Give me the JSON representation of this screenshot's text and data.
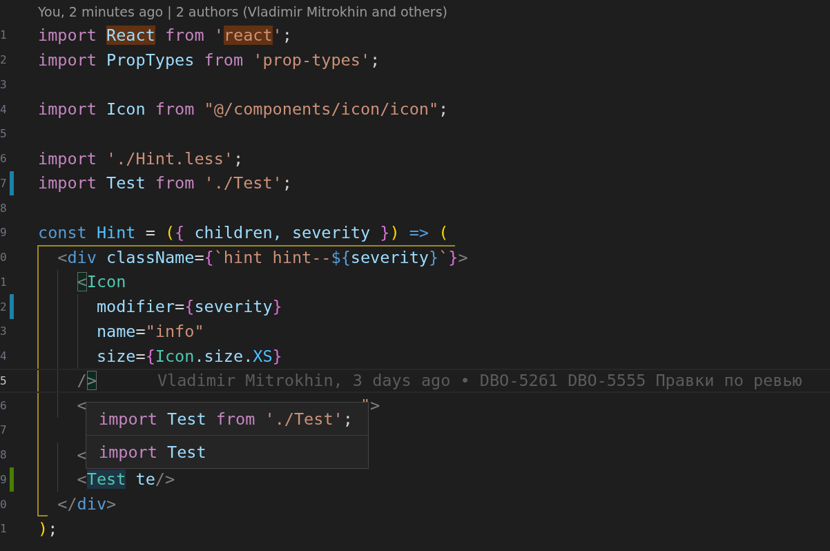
{
  "blame_header": "You, 2 minutes ago | 2 authors (Vladimir Mitrokhin and others)",
  "lines": [
    {
      "number": "1",
      "modified": false,
      "added": false,
      "in_bracket_pair": false,
      "current": false,
      "tokens": [
        {
          "text": "import ",
          "kind": "keyword"
        },
        {
          "text": "React",
          "kind": "variable",
          "find_match": true
        },
        {
          "text": " from",
          "kind": "keyword"
        },
        {
          "text": " '",
          "kind": "string"
        },
        {
          "text": "react",
          "kind": "string",
          "find_match": true
        },
        {
          "text": "'",
          "kind": "string"
        },
        {
          "text": ";",
          "kind": "plain"
        }
      ]
    },
    {
      "number": "2",
      "modified": false,
      "added": false,
      "in_bracket_pair": false,
      "current": false,
      "tokens": [
        {
          "text": "import",
          "kind": "keyword"
        },
        {
          "text": " PropTypes ",
          "kind": "variable"
        },
        {
          "text": "from",
          "kind": "keyword"
        },
        {
          "text": " 'prop-types'",
          "kind": "string"
        },
        {
          "text": ";",
          "kind": "plain"
        }
      ]
    },
    {
      "number": "3",
      "modified": false,
      "added": false,
      "in_bracket_pair": false,
      "current": false
    },
    {
      "number": "4",
      "modified": false,
      "added": false,
      "in_bracket_pair": false,
      "current": false,
      "tokens": [
        {
          "text": "import",
          "kind": "keyword"
        },
        {
          "text": " Icon ",
          "kind": "variable"
        },
        {
          "text": "from",
          "kind": "keyword"
        },
        {
          "text": " \"@/components/icon/icon\"",
          "kind": "string"
        },
        {
          "text": ";",
          "kind": "plain"
        }
      ]
    },
    {
      "number": "5",
      "modified": false,
      "added": false,
      "in_bracket_pair": false,
      "current": false
    },
    {
      "number": "6",
      "modified": false,
      "added": false,
      "in_bracket_pair": false,
      "current": false,
      "tokens": [
        {
          "text": "import",
          "kind": "keyword"
        },
        {
          "text": " './Hint.less'",
          "kind": "string"
        },
        {
          "text": ";",
          "kind": "plain"
        }
      ]
    },
    {
      "number": "7",
      "modified": true,
      "added": false,
      "in_bracket_pair": false,
      "current": false,
      "tokens": [
        {
          "text": "import",
          "kind": "keyword"
        },
        {
          "text": " Test ",
          "kind": "variable"
        },
        {
          "text": "from",
          "kind": "keyword"
        },
        {
          "text": " './Test'",
          "kind": "string"
        },
        {
          "text": ";",
          "kind": "plain"
        }
      ]
    },
    {
      "number": "8",
      "modified": false,
      "added": false,
      "in_bracket_pair": false,
      "current": false
    },
    {
      "number": "9",
      "modified": false,
      "added": false,
      "in_bracket_pair": false,
      "current": false,
      "tokens": [
        {
          "text": "const",
          "kind": "storage"
        },
        {
          "text": " Hint",
          "kind": "constant"
        },
        {
          "text": " = ",
          "kind": "plain"
        },
        {
          "text": "(",
          "kind": "bracket1"
        },
        {
          "text": "{",
          "kind": "bracket2"
        },
        {
          "text": " children, severity ",
          "kind": "variable"
        },
        {
          "text": "}",
          "kind": "bracket2"
        },
        {
          "text": ")",
          "kind": "bracket1"
        },
        {
          "text": " =>",
          "kind": "storage"
        },
        {
          "text": " (",
          "kind": "bracket1"
        }
      ]
    },
    {
      "number": "0",
      "modified": false,
      "added": false,
      "in_bracket_pair": true,
      "current": false,
      "tokens": [
        {
          "text": "  <",
          "kind": "angle"
        },
        {
          "text": "div",
          "kind": "storage"
        },
        {
          "text": " className",
          "kind": "variable"
        },
        {
          "text": "=",
          "kind": "plain"
        },
        {
          "text": "{",
          "kind": "bracket2"
        },
        {
          "text": "`hint hint--",
          "kind": "string"
        },
        {
          "text": "${",
          "kind": "storage"
        },
        {
          "text": "severity",
          "kind": "variable"
        },
        {
          "text": "}",
          "kind": "storage"
        },
        {
          "text": "`",
          "kind": "string"
        },
        {
          "text": "}",
          "kind": "bracket2"
        },
        {
          "text": ">",
          "kind": "angle"
        }
      ]
    },
    {
      "number": "1",
      "modified": false,
      "added": false,
      "in_bracket_pair": true,
      "current": false,
      "tokens": [
        {
          "text": "    <",
          "kind": "angle",
          "bracket_match": true
        },
        {
          "text": "Icon",
          "kind": "component"
        }
      ]
    },
    {
      "number": "2",
      "modified": true,
      "added": false,
      "in_bracket_pair": true,
      "current": false,
      "tokens": [
        {
          "text": "      modifier",
          "kind": "variable"
        },
        {
          "text": "=",
          "kind": "plain"
        },
        {
          "text": "{",
          "kind": "bracket2"
        },
        {
          "text": "severity",
          "kind": "variable"
        },
        {
          "text": "}",
          "kind": "bracket2"
        }
      ]
    },
    {
      "number": "3",
      "modified": false,
      "added": false,
      "in_bracket_pair": true,
      "current": false,
      "tokens": [
        {
          "text": "      name",
          "kind": "variable"
        },
        {
          "text": "=",
          "kind": "plain"
        },
        {
          "text": "\"info\"",
          "kind": "string"
        }
      ]
    },
    {
      "number": "4",
      "modified": false,
      "added": false,
      "in_bracket_pair": true,
      "current": false,
      "tokens": [
        {
          "text": "      size",
          "kind": "variable"
        },
        {
          "text": "=",
          "kind": "plain"
        },
        {
          "text": "{",
          "kind": "bracket2"
        },
        {
          "text": "Icon",
          "kind": "component"
        },
        {
          "text": ".size.",
          "kind": "variable"
        },
        {
          "text": "XS",
          "kind": "constant"
        },
        {
          "text": "}",
          "kind": "bracket2"
        }
      ]
    },
    {
      "number": "5",
      "modified": false,
      "added": false,
      "in_bracket_pair": true,
      "current": true,
      "tokens": [
        {
          "text": "    /",
          "kind": "angle"
        },
        {
          "text": ">",
          "kind": "angle",
          "bracket_match": true
        }
      ],
      "blame": "Vladimir Mitrokhin, 3 days ago • DBO-5261 DBO-5555 Правки по ревью"
    },
    {
      "number": "6",
      "modified": false,
      "added": false,
      "in_bracket_pair": true,
      "current": false,
      "tokens": [
        {
          "text": "    <",
          "kind": "angle"
        },
        {
          "text": "                            \"",
          "kind": "string"
        },
        {
          "text": ">",
          "kind": "angle"
        }
      ]
    },
    {
      "number": "7",
      "modified": false,
      "added": false,
      "in_bracket_pair": true,
      "current": false
    },
    {
      "number": "8",
      "modified": false,
      "added": false,
      "in_bracket_pair": true,
      "current": false,
      "tokens": [
        {
          "text": "    <",
          "kind": "angle"
        }
      ]
    },
    {
      "number": "9",
      "modified": false,
      "added": true,
      "in_bracket_pair": true,
      "current": false,
      "tokens": [
        {
          "text": "    <",
          "kind": "angle"
        },
        {
          "text": "Test",
          "kind": "component",
          "word_highlight": true
        },
        {
          "text": " te",
          "kind": "variable"
        },
        {
          "text": "/>",
          "kind": "angle"
        }
      ]
    },
    {
      "number": "0",
      "modified": false,
      "added": false,
      "in_bracket_pair": true,
      "current": false,
      "tokens": [
        {
          "text": "  </",
          "kind": "angle"
        },
        {
          "text": "div",
          "kind": "storage"
        },
        {
          "text": ">",
          "kind": "angle"
        }
      ]
    },
    {
      "number": "1",
      "modified": false,
      "added": false,
      "in_bracket_pair": false,
      "current": false,
      "tokens": [
        {
          "text": ")",
          "kind": "bracket1"
        },
        {
          "text": ";",
          "kind": "plain"
        }
      ]
    }
  ],
  "suggestion_popup": {
    "items": [
      {
        "selected": false,
        "tokens": [
          {
            "text": "import",
            "kind": "keyword"
          },
          {
            "text": " Test ",
            "kind": "variable"
          },
          {
            "text": "from",
            "kind": "keyword"
          },
          {
            "text": " './Test'",
            "kind": "string"
          },
          {
            "text": ";",
            "kind": "plain"
          }
        ]
      },
      {
        "selected": false,
        "tokens": [
          {
            "text": "import",
            "kind": "keyword"
          },
          {
            "text": " Test",
            "kind": "variable"
          }
        ]
      }
    ]
  }
}
